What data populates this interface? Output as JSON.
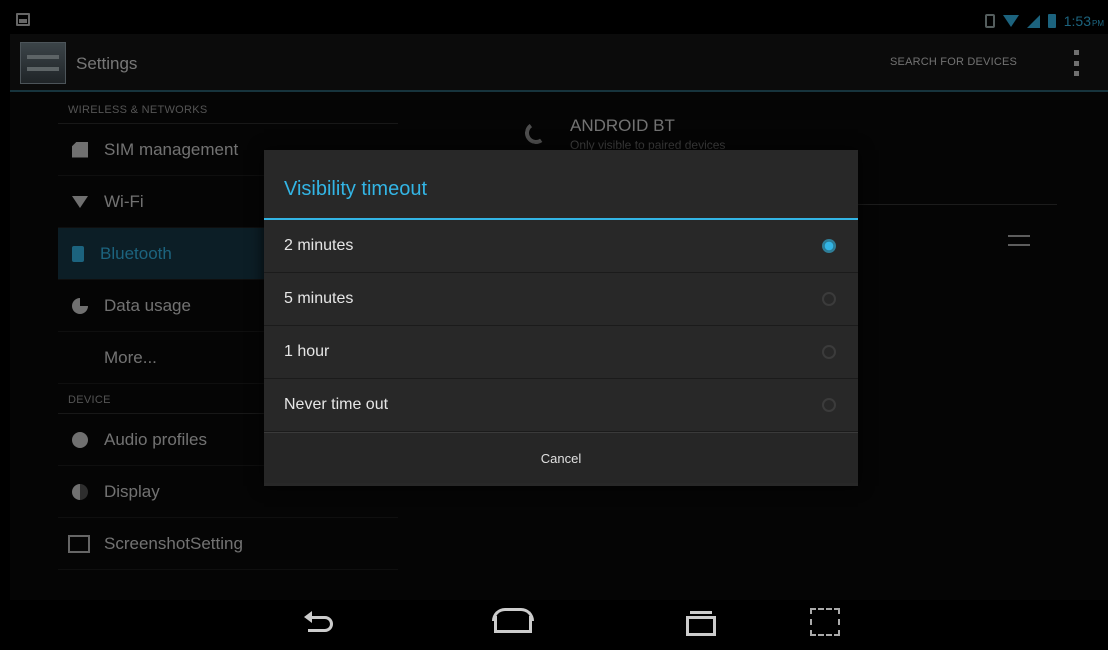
{
  "status_bar": {
    "time": "1:53",
    "ampm": "PM"
  },
  "action_bar": {
    "title": "Settings",
    "search_label": "SEARCH FOR DEVICES"
  },
  "settings_list": {
    "wireless_header": "WIRELESS & NETWORKS",
    "device_header": "DEVICE",
    "items": [
      {
        "label": "SIM management",
        "icon": "sim-icon"
      },
      {
        "label": "Wi-Fi",
        "icon": "wifi-icon"
      },
      {
        "label": "Bluetooth",
        "icon": "bluetooth-icon"
      },
      {
        "label": "Data usage",
        "icon": "data-usage-icon"
      },
      {
        "label": "More...",
        "icon": ""
      },
      {
        "label": "Audio profiles",
        "icon": "audio-profiles-icon"
      },
      {
        "label": "Display",
        "icon": "display-icon"
      },
      {
        "label": "ScreenshotSetting",
        "icon": "screenshot-icon"
      }
    ],
    "selected": "Bluetooth"
  },
  "bluetooth_pane": {
    "device_name": "ANDROID BT",
    "device_status": "Only visible to paired devices"
  },
  "dialog": {
    "title": "Visibility timeout",
    "options": [
      {
        "label": "2 minutes",
        "selected": true
      },
      {
        "label": "5 minutes",
        "selected": false
      },
      {
        "label": "1 hour",
        "selected": false
      },
      {
        "label": "Never time out",
        "selected": false
      }
    ],
    "cancel_label": "Cancel"
  },
  "colors": {
    "accent": "#33b5e5",
    "background": "#0a0a0a",
    "dialog": "#282828"
  }
}
